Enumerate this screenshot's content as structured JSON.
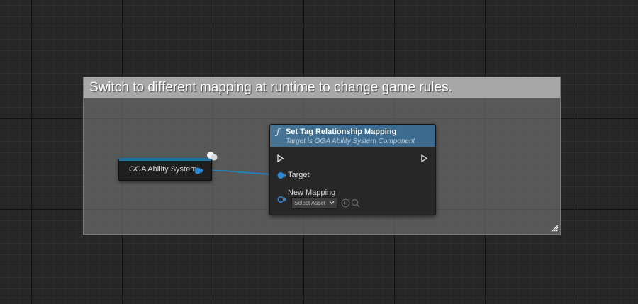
{
  "comment": {
    "text": "Switch to different mapping at runtime to change game rules."
  },
  "variable_node": {
    "label": "GGA Ability System",
    "color": "#1d6fa8"
  },
  "function_node": {
    "icon": "function-icon",
    "icon_glyph": "ƒ",
    "title": "Set Tag Relationship Mapping",
    "subtitle": "Target is GGA Ability System Component",
    "header_color": "#3d6d92",
    "pins": {
      "target_label": "Target",
      "mapping_label": "New Mapping",
      "asset_select_value": "Select Asset"
    }
  },
  "colors": {
    "object_pin": "#2a8ad8",
    "wire": "#1f86c8",
    "background": "#262626"
  }
}
